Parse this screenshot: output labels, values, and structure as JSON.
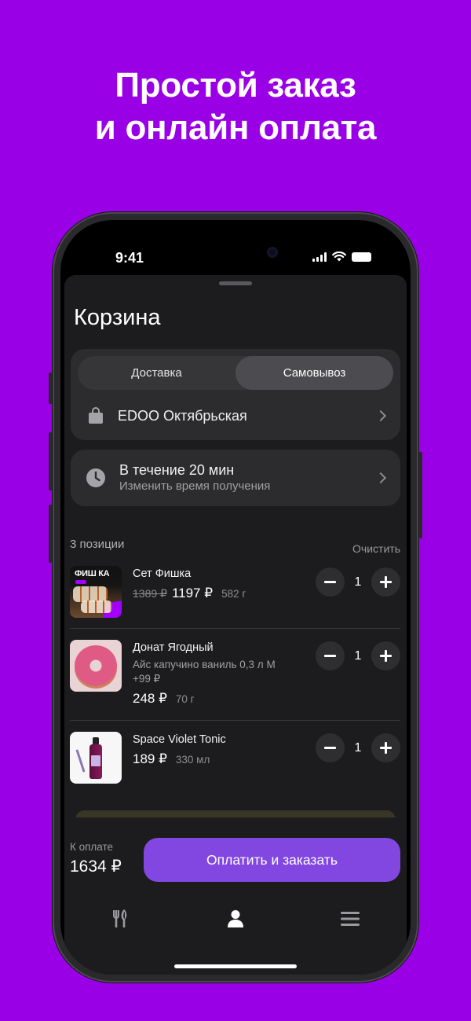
{
  "promo": {
    "line1": "Простой заказ",
    "line2": "и онлайн оплата"
  },
  "colors": {
    "background": "#9a00e6",
    "accent": "#8147e0",
    "sheet": "#1c1c1e"
  },
  "status_bar": {
    "time": "9:41",
    "icons": [
      "signal-icon",
      "wifi-icon",
      "battery-icon"
    ]
  },
  "cart": {
    "title": "Корзина",
    "delivery_tabs": [
      {
        "label": "Доставка",
        "active": false
      },
      {
        "label": "Самовывоз",
        "active": true
      }
    ],
    "store": {
      "name": "EDOO Октябрьская",
      "icon": "bag-icon"
    },
    "pickup_time": {
      "title": "В течение 20 мин",
      "subtitle": "Изменить время получения",
      "icon": "clock-icon"
    },
    "items_count": "3 позиции",
    "clear_label": "Очистить",
    "items": [
      {
        "name": "Сет Фишка",
        "old_price": "1389 ₽",
        "price": "1197 ₽",
        "weight": "582 г",
        "quantity": "1",
        "thumb_text": "ФИШ КА"
      },
      {
        "name": "Донат Ягодный",
        "modifier": "Айс капучино ваниль 0,3 л М",
        "modifier_price": "+99 ₽",
        "price": "248 ₽",
        "weight": "70 г",
        "quantity": "1"
      },
      {
        "name": "Space Violet Tonic",
        "price": "189 ₽",
        "weight": "330 мл",
        "quantity": "1"
      }
    ],
    "total_label": "К оплате",
    "total": "1634 ₽",
    "pay_button": "Оплатить и заказать"
  },
  "tabbar": {
    "tabs": [
      "menu-icon",
      "profile-icon",
      "more-icon"
    ],
    "active": "profile-icon"
  }
}
